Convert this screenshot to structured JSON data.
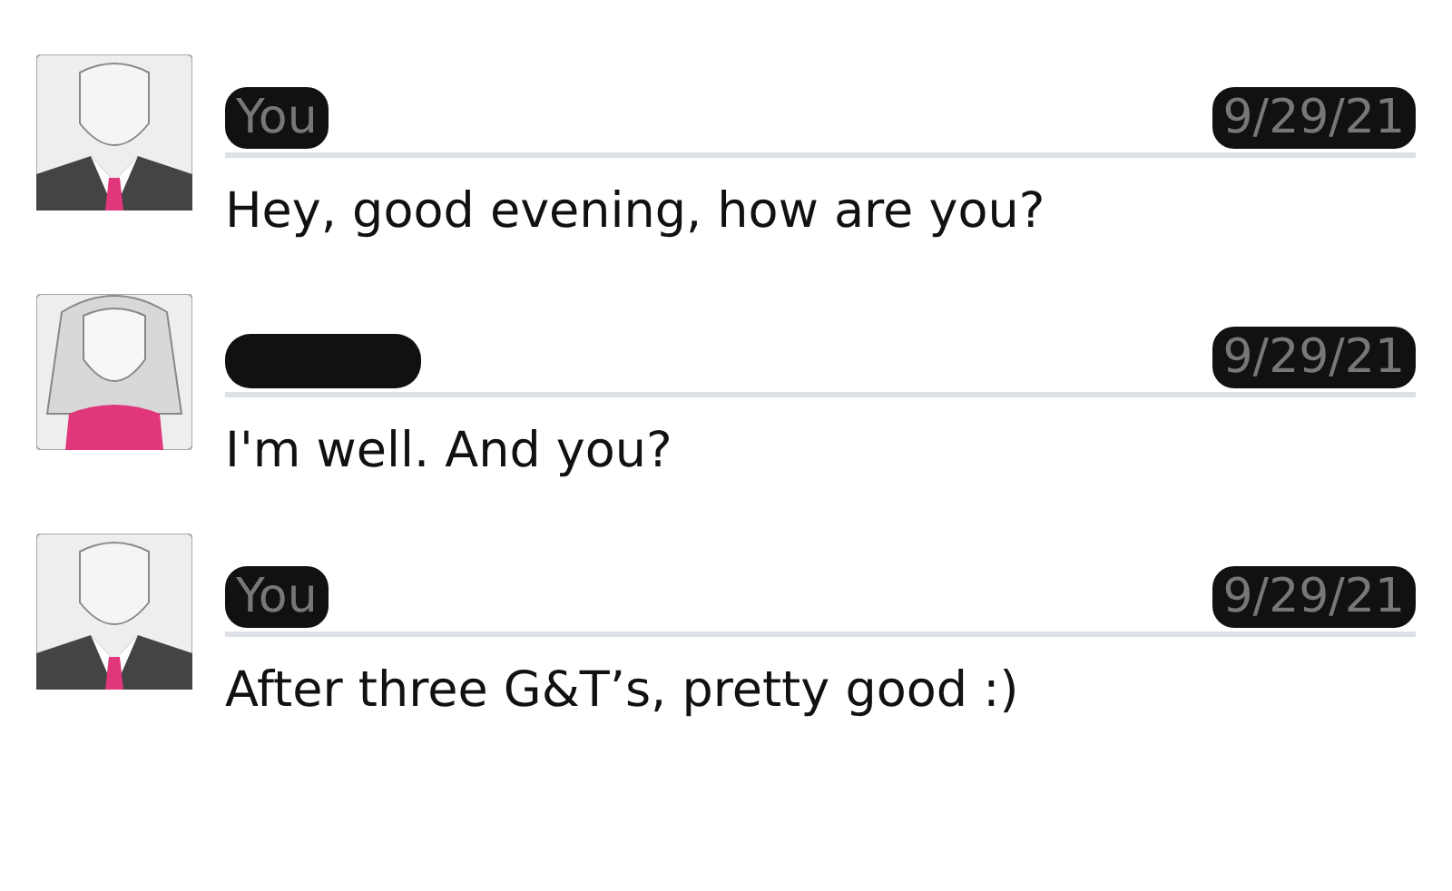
{
  "messages": [
    {
      "kind": "man",
      "sender": "You",
      "sender_redacted": true,
      "date": "9/29/21",
      "text": "Hey, good evening, how are you?"
    },
    {
      "kind": "woman",
      "sender_redacted": true,
      "date": "9/29/21",
      "text": "I'm well. And you?"
    },
    {
      "kind": "man",
      "sender": "You",
      "sender_redacted": true,
      "date": "9/29/21",
      "text": "After three G&T’s, pretty good :)"
    }
  ]
}
